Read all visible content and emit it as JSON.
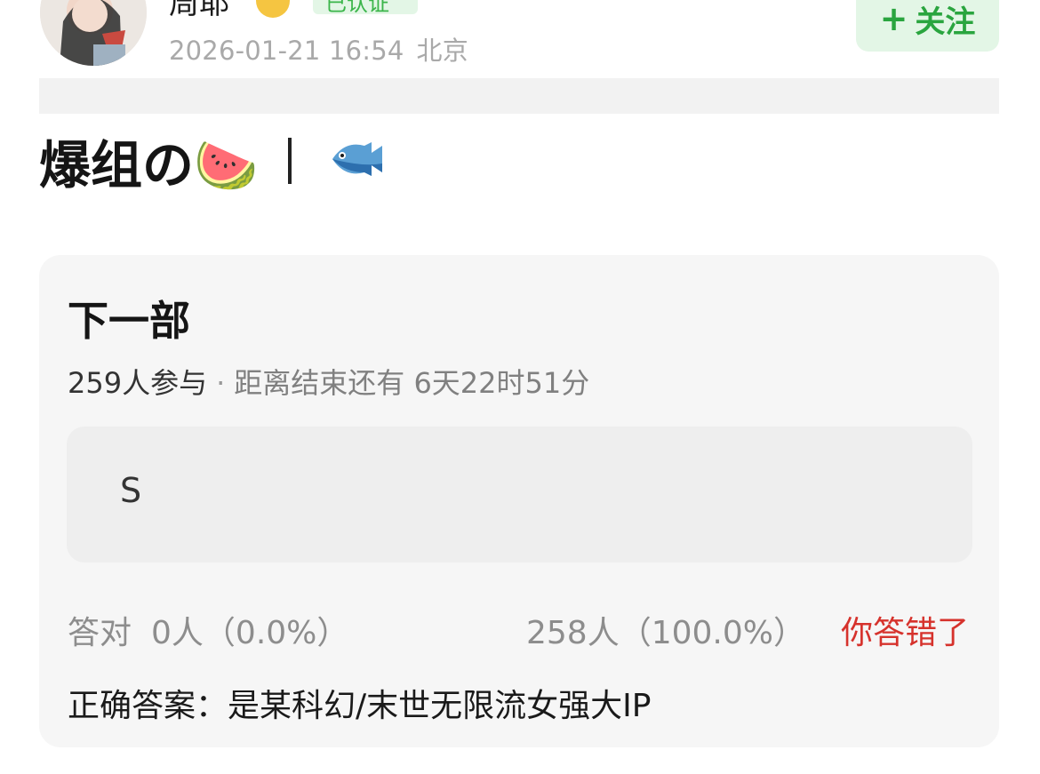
{
  "author": {
    "name": "周耶",
    "verified_label": "已认证",
    "timestamp": "2026-01-21 16:54",
    "location": "北京"
  },
  "follow_button": {
    "label": "关注",
    "plus": "+"
  },
  "post": {
    "title": "爆组の🍉",
    "fish_emoji": "🐟"
  },
  "quiz": {
    "title": "下一部",
    "participants": "259人参与",
    "deadline": "距离结束还有 6天22时51分",
    "option_text": "S",
    "correct_label": "答对",
    "correct_stats": "0人（0.0%）",
    "wrong_stats": "258人（100.0%）",
    "wrong_label": "你答错了",
    "answer": "正确答案：是某科幻/末世无限流女强大IP"
  },
  "colors": {
    "accent_green": "#2aa53f",
    "follow_bg": "#e3f6e6",
    "wrong_red": "#d6322c",
    "card_bg": "#f6f6f6"
  }
}
